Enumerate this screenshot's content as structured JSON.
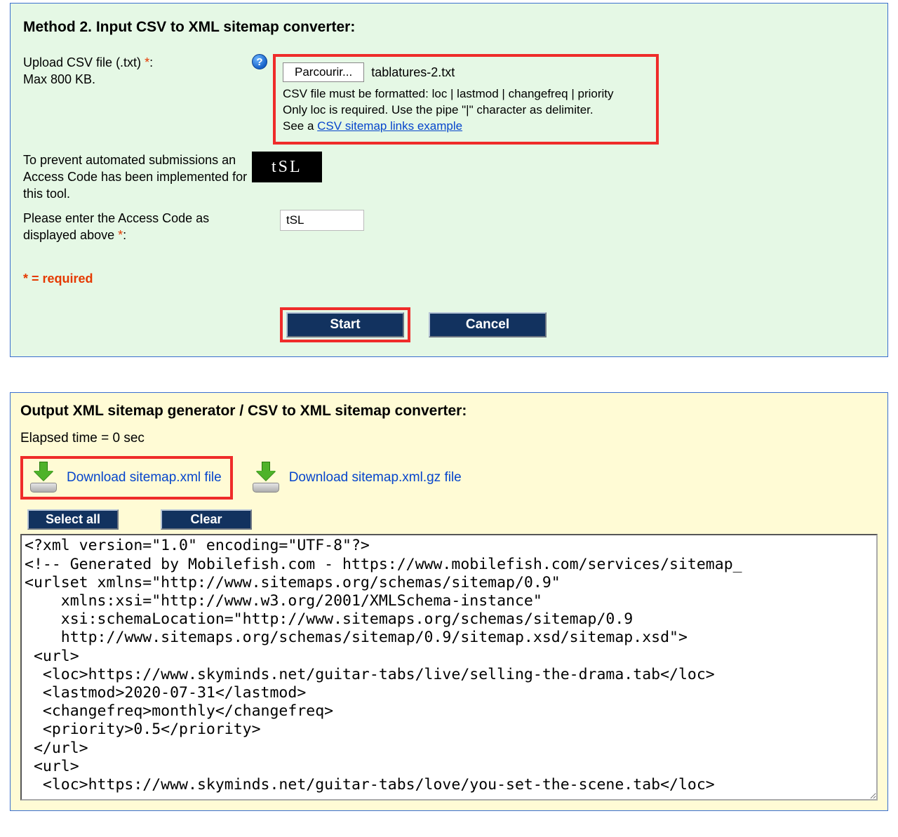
{
  "method2": {
    "title": "Method 2. Input CSV to XML sitemap converter:",
    "upload_label_line1": "Upload CSV file (.txt) ",
    "upload_label_line2": "Max 800 KB.",
    "required_marker": "*",
    "colon": ":",
    "browse_label": "Parcourir...",
    "selected_file": "tablatures-2.txt",
    "hint_line1": "CSV file must be formatted: loc | lastmod | changefreq | priority",
    "hint_line2": "Only loc is required. Use the pipe \"|\" character as delimiter.",
    "hint_see_a": "See a ",
    "hint_link": "CSV sitemap links example",
    "captcha_explain": "To prevent automated submissions an Access Code has been implemented for this tool.",
    "captcha_value": "tSL",
    "access_prompt_line1": "Please enter the Access Code as displayed above ",
    "access_value": "tSL",
    "required_legend": "* = required",
    "start_label": "Start",
    "cancel_label": "Cancel"
  },
  "output": {
    "title": "Output XML sitemap generator / CSV to XML sitemap converter:",
    "elapsed": "Elapsed time = 0 sec",
    "download_xml": "Download sitemap.xml file",
    "download_gz": "Download sitemap.xml.gz file",
    "select_all": "Select all",
    "clear": "Clear",
    "xml": "<?xml version=\"1.0\" encoding=\"UTF-8\"?>\n<!-- Generated by Mobilefish.com - https://www.mobilefish.com/services/sitemap_\n<urlset xmlns=\"http://www.sitemaps.org/schemas/sitemap/0.9\"\n    xmlns:xsi=\"http://www.w3.org/2001/XMLSchema-instance\"\n    xsi:schemaLocation=\"http://www.sitemaps.org/schemas/sitemap/0.9\n    http://www.sitemaps.org/schemas/sitemap/0.9/sitemap.xsd/sitemap.xsd\">\n <url>\n  <loc>https://www.skyminds.net/guitar-tabs/live/selling-the-drama.tab</loc>\n  <lastmod>2020-07-31</lastmod>\n  <changefreq>monthly</changefreq>\n  <priority>0.5</priority>\n </url>\n <url>\n  <loc>https://www.skyminds.net/guitar-tabs/love/you-set-the-scene.tab</loc>"
  }
}
